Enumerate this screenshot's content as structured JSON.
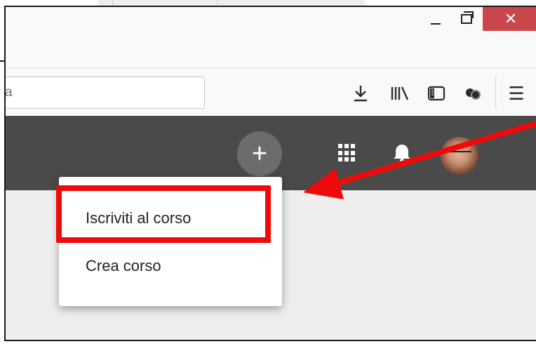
{
  "window": {
    "minimize_icon": "minimize-icon",
    "maximize_icon": "restore-icon",
    "close_symbol": "✕"
  },
  "toolbar": {
    "url_text": "a",
    "icons": [
      "download-icon",
      "library-icon",
      "sidebar-icon",
      "extension-icon",
      "menu-icon"
    ],
    "menu_symbol": "☰"
  },
  "appbar": {
    "add_symbol": "+",
    "icons": [
      "apps-grid-icon",
      "notifications-icon",
      "user-avatar"
    ],
    "background": "#4a4a4a"
  },
  "dropdown": {
    "items": [
      {
        "label": "Iscriviti al corso"
      },
      {
        "label": "Crea corso"
      }
    ]
  },
  "annotation": {
    "highlight_color": "#ee0a0a"
  }
}
